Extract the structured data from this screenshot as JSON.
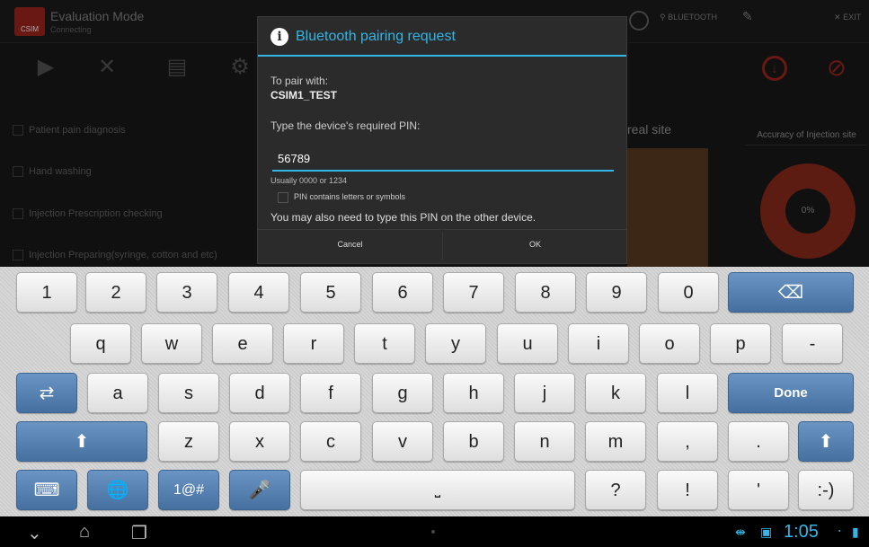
{
  "background_app": {
    "title": "Evaluation Mode",
    "status": "Connecting",
    "logo_text": "CSIM",
    "top_bluetooth": "BLUETOOTH",
    "top_exit": "EXIT",
    "checklist": [
      "Patient pain diagnosis",
      "Hand washing",
      "Injection Prescription checking",
      "Injection Preparing(syringe, cotton and etc)"
    ],
    "real_site": "real site",
    "accuracy_label": "Accuracy of Injection site",
    "accuracy_value": "0%",
    "accent_red": "#a3261f"
  },
  "dialog": {
    "title": "Bluetooth pairing request",
    "pair_with_label": "To pair with:",
    "device_name": "CSIM1_TEST",
    "pin_prompt": "Type the device's required PIN:",
    "pin_value": "56789",
    "pin_hint": "Usually 0000 or 1234",
    "pin_checkbox_label": "PIN contains letters or symbols",
    "also_note": "You may also need to type this PIN on the other device.",
    "cancel_label": "Cancel",
    "ok_label": "OK",
    "accent": "#33b5e5"
  },
  "keyboard": {
    "row1": [
      "1",
      "2",
      "3",
      "4",
      "5",
      "6",
      "7",
      "8",
      "9",
      "0"
    ],
    "row2": [
      "q",
      "w",
      "e",
      "r",
      "t",
      "y",
      "u",
      "i",
      "o",
      "p",
      "-"
    ],
    "row3": [
      "a",
      "s",
      "d",
      "f",
      "g",
      "h",
      "j",
      "k",
      "l"
    ],
    "row4": [
      "z",
      "x",
      "c",
      "v",
      "b",
      "n",
      "m",
      ",",
      "."
    ],
    "done_label": "Done",
    "sym_label": "1@#",
    "punct": [
      "?",
      "!",
      "'",
      ":-)"
    ]
  },
  "statusbar": {
    "time": "1:05"
  }
}
